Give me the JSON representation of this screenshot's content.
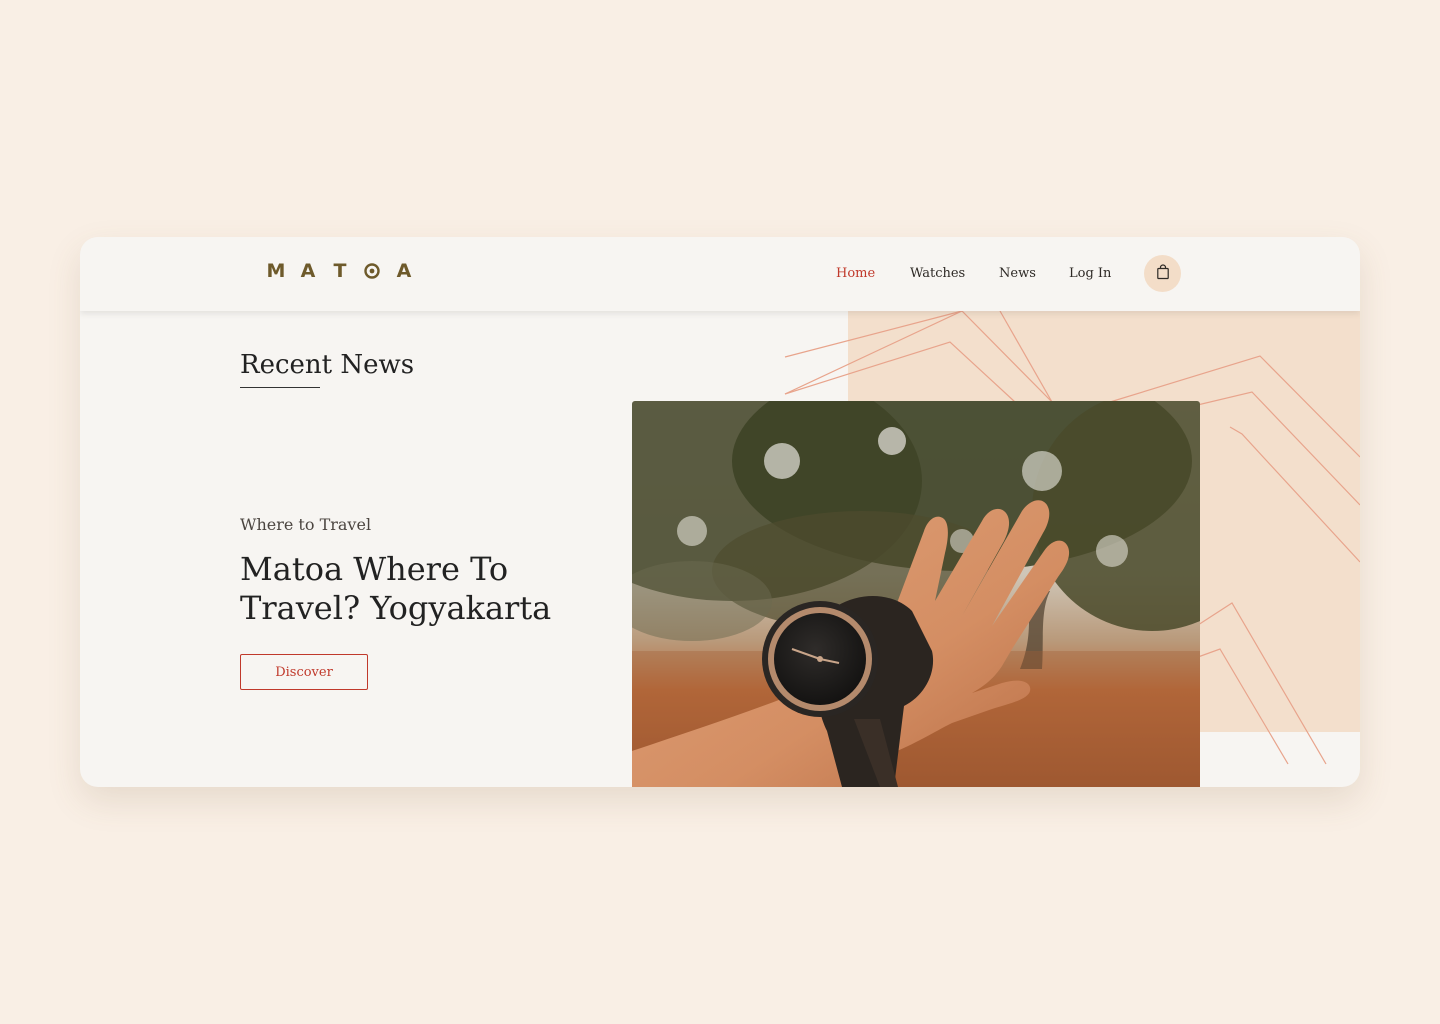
{
  "brand": {
    "logo_letters": [
      "M",
      "A",
      "T",
      "O",
      "A"
    ],
    "logo_color": "#6e5a2b"
  },
  "nav": {
    "items": [
      {
        "label": "Home",
        "active": true
      },
      {
        "label": "Watches",
        "active": false
      },
      {
        "label": "News",
        "active": false
      },
      {
        "label": "Log In",
        "active": false
      }
    ],
    "active_color": "#c0392b",
    "cart_icon": "shopping-bag-icon"
  },
  "main": {
    "section_title": "Recent News",
    "article": {
      "category": "Where to Travel",
      "headline": "Matoa Where To Travel? Yogyakarta",
      "cta_label": "Discover"
    },
    "hero_image": {
      "subject": "hand-with-wooden-watch-photo"
    }
  },
  "colors": {
    "page_background": "#f9efe5",
    "card_background": "#f7f5f2",
    "accent": "#c0392b",
    "decor_peach": "#f3dfcc",
    "decor_lines": "#e8a48c"
  }
}
